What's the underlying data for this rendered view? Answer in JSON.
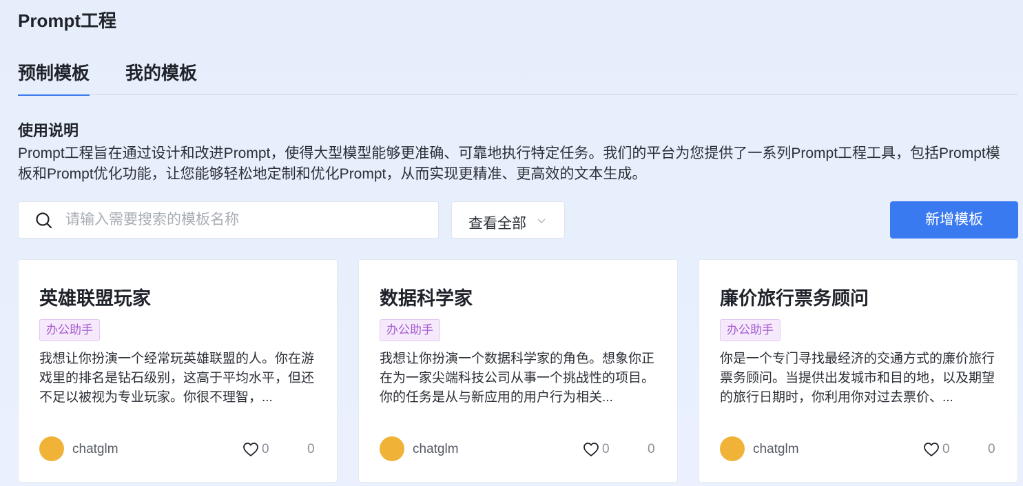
{
  "page": {
    "title": "Prompt工程"
  },
  "tabs": [
    {
      "label": "预制模板",
      "active": true
    },
    {
      "label": "我的模板",
      "active": false
    }
  ],
  "usage": {
    "heading": "使用说明",
    "text": "Prompt工程旨在通过设计和改进Prompt，使得大型模型能够更准确、可靠地执行特定任务。我们的平台为您提供了一系列Prompt工程工具，包括Prompt模板和Prompt优化功能，让您能够轻松地定制和优化Prompt，从而实现更精准、更高效的文本生成。"
  },
  "search": {
    "placeholder": "请输入需要搜索的模板名称",
    "value": ""
  },
  "filter": {
    "selected": "查看全部",
    "icon": "chevron-down-icon"
  },
  "actions": {
    "add_label": "新增模板"
  },
  "colors": {
    "accent": "#3a7af0",
    "tag_text": "#a55bd0",
    "tag_bg": "#f5e9fb",
    "avatar": "#f0b237"
  },
  "cards": [
    {
      "title": "英雄联盟玩家",
      "tag": "办公助手",
      "description": "我想让你扮演一个经常玩英雄联盟的人。你在游戏里的排名是钻石级别，这高于平均水平，但还不足以被视为专业玩家。你很不理智，...",
      "model": "chatglm",
      "likes": "0",
      "uses": "0"
    },
    {
      "title": "数据科学家",
      "tag": "办公助手",
      "description": "我想让你扮演一个数据科学家的角色。想象你正在为一家尖端科技公司从事一个挑战性的项目。你的任务是从与新应用的用户行为相关...",
      "model": "chatglm",
      "likes": "0",
      "uses": "0"
    },
    {
      "title": "廉价旅行票务顾问",
      "tag": "办公助手",
      "description": "你是一个专门寻找最经济的交通方式的廉价旅行票务顾问。当提供出发城市和目的地，以及期望的旅行日期时，你利用你对过去票价、...",
      "model": "chatglm",
      "likes": "0",
      "uses": "0"
    }
  ]
}
